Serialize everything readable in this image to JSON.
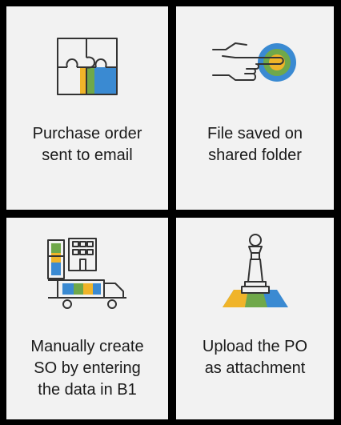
{
  "tiles": [
    {
      "caption": "Purchase order\nsent to email",
      "icon": "puzzle-icon"
    },
    {
      "caption": "File saved on\nshared folder",
      "icon": "hand-pointing-icon"
    },
    {
      "caption": "Manually create\nSO by entering\nthe data in B1",
      "icon": "factory-truck-icon"
    },
    {
      "caption": "Upload the PO\nas attachment",
      "icon": "chess-pawn-icon"
    }
  ],
  "colors": {
    "blue": "#3a8ad2",
    "yellow": "#f0b429",
    "green": "#6fa84a",
    "tile_bg": "#f2f2f2",
    "line": "#333333"
  }
}
